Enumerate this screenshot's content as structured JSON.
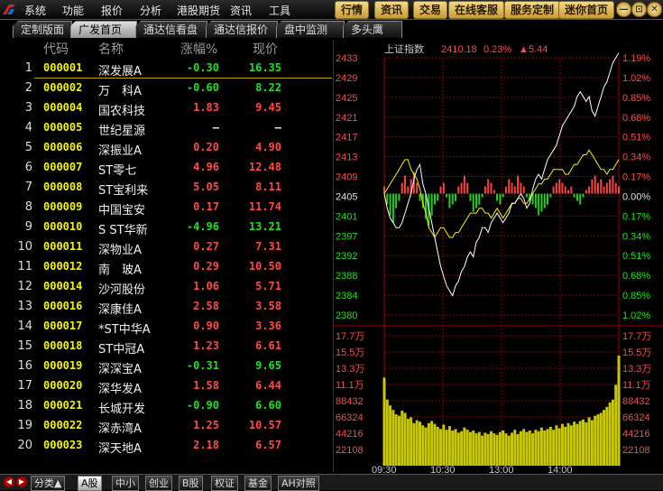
{
  "menu": {
    "left_items": [
      "系统",
      "功能",
      "报价",
      "分析",
      "港股期货",
      "资讯",
      "工具"
    ],
    "right_buttons": [
      "行情",
      "资讯",
      "交易",
      "在线客服",
      "服务定制",
      "迷你首页"
    ],
    "window_buttons": [
      "—",
      "⊡",
      "✕"
    ]
  },
  "tabs": [
    {
      "label": "定制版面"
    },
    {
      "label": "广发首页"
    },
    {
      "label": "通达信看盘"
    },
    {
      "label": "通达信报价"
    },
    {
      "label": "盘中监测"
    },
    {
      "label": "多头鹰"
    }
  ],
  "active_tab_index": 1,
  "table": {
    "headers": {
      "code": "代码",
      "name": "名称",
      "pct": "涨幅%",
      "price": "现价"
    },
    "rows": [
      {
        "idx": "1",
        "code": "000001",
        "name": "深发展A",
        "pct": "-0.30",
        "price": "16.35",
        "dir": "down"
      },
      {
        "idx": "2",
        "code": "000002",
        "name": "万　科A",
        "pct": "-0.60",
        "price": "8.22",
        "dir": "down"
      },
      {
        "idx": "3",
        "code": "000004",
        "name": "国农科技",
        "pct": "1.83",
        "price": "9.45",
        "dir": "up"
      },
      {
        "idx": "4",
        "code": "000005",
        "name": "世纪星源",
        "pct": "—",
        "price": "—",
        "dir": "flat"
      },
      {
        "idx": "5",
        "code": "000006",
        "name": "深振业A",
        "pct": "0.20",
        "price": "4.90",
        "dir": "up"
      },
      {
        "idx": "6",
        "code": "000007",
        "name": "ST零七",
        "pct": "4.96",
        "price": "12.48",
        "dir": "up"
      },
      {
        "idx": "7",
        "code": "000008",
        "name": "ST宝利来",
        "pct": "5.05",
        "price": "8.11",
        "dir": "up"
      },
      {
        "idx": "8",
        "code": "000009",
        "name": "中国宝安",
        "pct": "0.17",
        "price": "11.74",
        "dir": "up"
      },
      {
        "idx": "9",
        "code": "000010",
        "name": "S ST华新",
        "pct": "-4.96",
        "price": "13.21",
        "dir": "down"
      },
      {
        "idx": "10",
        "code": "000011",
        "name": "深物业A",
        "pct": "0.27",
        "price": "7.31",
        "dir": "up"
      },
      {
        "idx": "11",
        "code": "000012",
        "name": "南　玻A",
        "pct": "0.29",
        "price": "10.50",
        "dir": "up"
      },
      {
        "idx": "12",
        "code": "000014",
        "name": "沙河股份",
        "pct": "1.06",
        "price": "5.71",
        "dir": "up"
      },
      {
        "idx": "13",
        "code": "000016",
        "name": "深康佳A",
        "pct": "2.58",
        "price": "3.58",
        "dir": "up"
      },
      {
        "idx": "14",
        "code": "000017",
        "name": "*ST中华A",
        "pct": "0.90",
        "price": "3.36",
        "dir": "up"
      },
      {
        "idx": "15",
        "code": "000018",
        "name": "ST中冠A",
        "pct": "1.23",
        "price": "6.61",
        "dir": "up"
      },
      {
        "idx": "16",
        "code": "000019",
        "name": "深深宝A",
        "pct": "-0.31",
        "price": "9.65",
        "dir": "down"
      },
      {
        "idx": "17",
        "code": "000020",
        "name": "深华发A",
        "pct": "1.58",
        "price": "6.44",
        "dir": "up"
      },
      {
        "idx": "18",
        "code": "000021",
        "name": "长城开发",
        "pct": "-0.90",
        "price": "6.60",
        "dir": "down"
      },
      {
        "idx": "19",
        "code": "000022",
        "name": "深赤湾A",
        "pct": "1.25",
        "price": "10.57",
        "dir": "up"
      },
      {
        "idx": "20",
        "code": "000023",
        "name": "深天地A",
        "pct": "2.18",
        "price": "6.57",
        "dir": "up"
      }
    ]
  },
  "chart_data": {
    "type": "line",
    "title": "上证指数",
    "last_value": "2410.18",
    "change_pct": "0.23%",
    "change_pts": "▲5.44",
    "base": 2405,
    "price_ticks_left": [
      "2433",
      "2429",
      "2425",
      "2421",
      "2417",
      "2413",
      "2409",
      "2405",
      "2401",
      "2397",
      "2392",
      "2388",
      "2384",
      "2380"
    ],
    "pct_ticks_right": [
      "1.19%",
      "1.02%",
      "0.85%",
      "0.68%",
      "0.51%",
      "0.34%",
      "0.17%",
      "0.00%",
      "0.17%",
      "0.34%",
      "0.51%",
      "0.68%",
      "0.85%",
      "1.02%"
    ],
    "volume_ticks_left": [
      "17.7万",
      "15.5万",
      "13.3万",
      "11.1万",
      "88432",
      "66324",
      "44216",
      "22108"
    ],
    "volume_ticks_right": [
      "17.7万",
      "15.5万",
      "13.3万",
      "11.1万",
      "88432",
      "66324",
      "44216",
      "22108"
    ],
    "time_ticks": [
      "09:30",
      "10:30",
      "13:00",
      "14:00"
    ],
    "index_series": [
      2405,
      2402,
      2400,
      2399,
      2398,
      2398,
      2399,
      2401,
      2403,
      2405,
      2408,
      2410,
      2411,
      2407,
      2405,
      2402,
      2399,
      2396,
      2393,
      2390,
      2388,
      2386,
      2385,
      2384,
      2386,
      2387,
      2389,
      2390,
      2392,
      2393,
      2392,
      2395,
      2396,
      2398,
      2398,
      2397,
      2399,
      2400,
      2401,
      2400,
      2399,
      2400,
      2401,
      2403,
      2403,
      2404,
      2405,
      2404,
      2402,
      2403,
      2406,
      2408,
      2409,
      2408,
      2410,
      2412,
      2413,
      2414,
      2415,
      2417,
      2419,
      2420,
      2421,
      2422,
      2423,
      2425,
      2426,
      2425,
      2424,
      2425,
      2422,
      2421,
      2423,
      2425,
      2427,
      2428,
      2430,
      2432,
      2433,
      2434
    ],
    "avg_series": [
      2405,
      2406,
      2407,
      2408,
      2409,
      2410,
      2411,
      2412,
      2412,
      2410,
      2409,
      2408,
      2406,
      2403,
      2401,
      2398,
      2397,
      2396,
      2397,
      2398,
      2398,
      2397,
      2396,
      2396,
      2397,
      2397,
      2398,
      2399,
      2400,
      2401,
      2401,
      2401,
      2402,
      2402,
      2401,
      2401,
      2400,
      2401,
      2402,
      2401,
      2400,
      2401,
      2402,
      2403,
      2403,
      2404,
      2404,
      2403,
      2403,
      2404,
      2405,
      2406,
      2407,
      2407,
      2408,
      2408,
      2409,
      2410,
      2410,
      2410,
      2410,
      2409,
      2409,
      2410,
      2411,
      2411,
      2412,
      2413,
      2413,
      2414,
      2413,
      2412,
      2411,
      2410,
      2410,
      2409,
      2410,
      2410,
      2411,
      2412
    ],
    "strength_bars": [
      2,
      -3,
      -6,
      -8,
      -4,
      -2,
      3,
      5,
      2,
      4,
      6,
      3,
      -2,
      -4,
      -7,
      -9,
      -6,
      -3,
      -2,
      2,
      3,
      -1,
      -4,
      -3,
      -2,
      2,
      3,
      5,
      3,
      -2,
      -5,
      -4,
      -3,
      -1,
      2,
      4,
      3,
      1,
      -2,
      -3,
      -1,
      2,
      4,
      3,
      2,
      5,
      3,
      2,
      -1,
      -2,
      -3,
      -4,
      -6,
      -5,
      -4,
      -3,
      -1,
      2,
      3,
      4,
      3,
      2,
      1,
      2,
      -1,
      -2,
      -3,
      -1,
      1,
      2,
      4,
      5,
      3,
      4,
      2,
      3,
      4,
      5,
      3,
      2
    ],
    "volume_bars": [
      120000,
      90000,
      82000,
      76000,
      70000,
      68000,
      75000,
      72000,
      64000,
      66000,
      58000,
      62000,
      60000,
      55000,
      52000,
      58000,
      61000,
      57000,
      53000,
      50000,
      56000,
      49000,
      54000,
      48000,
      50000,
      45000,
      47000,
      52000,
      49000,
      46000,
      48000,
      44000,
      46000,
      41000,
      45000,
      43000,
      47000,
      44000,
      42000,
      46000,
      48000,
      44000,
      41000,
      45000,
      49000,
      43000,
      47000,
      50000,
      46000,
      48000,
      44000,
      49000,
      47000,
      52000,
      48000,
      50000,
      53000,
      49000,
      55000,
      51000,
      57000,
      53000,
      58000,
      55000,
      60000,
      57000,
      61000,
      63000,
      59000,
      66000,
      62000,
      68000,
      70000,
      72000,
      76000,
      80000,
      86000,
      90000,
      110000,
      150000
    ],
    "price_range": [
      2380,
      2433
    ],
    "volume_max": 177000
  },
  "bottom_tabs": [
    "分类▲",
    "A股",
    "中小",
    "创业",
    "B股",
    "权证",
    "基金",
    "AH对照"
  ],
  "active_bottom_tab_index": 1,
  "colors": {
    "up": "#ff4a4a",
    "down": "#20e020",
    "code": "#f5f500",
    "grid": "#a00000",
    "index_line": "#ffffff",
    "avg_line": "#f5f500",
    "volume": "#c8c800"
  }
}
